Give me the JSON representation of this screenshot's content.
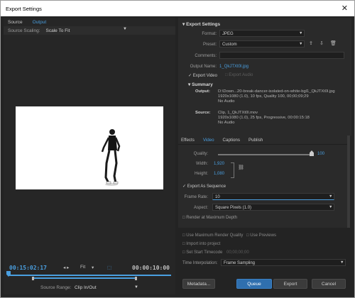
{
  "window": {
    "title": "Export Settings",
    "close": "✕"
  },
  "left": {
    "tabs": [
      "Source",
      "Output"
    ],
    "source_scaling_label": "Source Scaling:",
    "source_scaling_value": "Scale To Fit",
    "timecode_current": "00:15:02:17",
    "fit_label": "Fit",
    "timecode_end": "00:00:10:00",
    "source_range_label": "Source Range:",
    "source_range_value": "Clip In/Out"
  },
  "export_settings": {
    "header": "Export Settings",
    "format_label": "Format:",
    "format_value": "JPEG",
    "preset_label": "Preset:",
    "preset_value": "Custom",
    "comments_label": "Comments:",
    "output_name_label": "Output Name:",
    "output_name_value": "1_QkJTXt0l.jpg",
    "export_video": "Export Video",
    "export_audio": "Export Audio",
    "summary_header": "Summary",
    "output_label": "Output:",
    "output_lines": [
      "D:\\Down...20-break-dancer-isolated-on-white-bgl1_QkJTXt0l.jpg",
      "1920x1080 (1.0), 10 fps, Quality 100, 00;00;09;29",
      "No Audio"
    ],
    "source_label": "Source:",
    "source_lines": [
      "Clip, 1_QkJTXt0l.mov",
      "1920x1080 (1.0), 25 fps, Progressive, 00:00:15:18",
      "No Audio"
    ]
  },
  "effects": {
    "tabs": [
      "Effects",
      "Video",
      "Captions",
      "Publish"
    ],
    "quality_label": "Quality:",
    "quality_value": "100",
    "width_label": "Width:",
    "width_value": "1,920",
    "height_label": "Height:",
    "height_value": "1,080",
    "export_as_sequence": "Export As Sequence",
    "frame_rate_label": "Frame Rate:",
    "frame_rate_value": "10",
    "aspect_label": "Aspect:",
    "aspect_value": "Square Pixels (1.0)",
    "render_max_depth": "Render at Maximum Depth"
  },
  "bottom": {
    "use_max_render": "Use Maximum Render Quality",
    "use_previews": "Use Previews",
    "import_project": "Import into project",
    "set_start_tc": "Set Start Timecode",
    "start_tc_value": "00;00;00;00",
    "time_interp_label": "Time Interpolation:",
    "time_interp_value": "Frame Sampling"
  },
  "buttons": {
    "metadata": "Metadata...",
    "queue": "Queue",
    "export": "Export",
    "cancel": "Cancel"
  },
  "colors": {
    "accent": "#4a9fe0",
    "panel": "#2a2a2a",
    "background": "#232323"
  }
}
